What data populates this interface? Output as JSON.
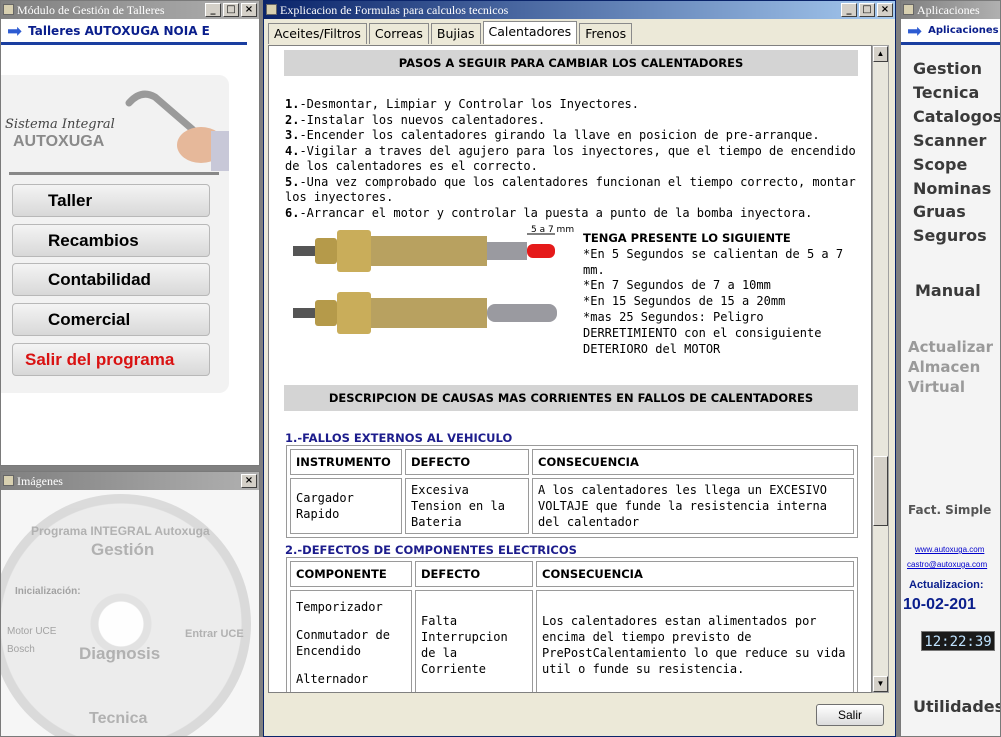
{
  "left_window": {
    "title": "Módulo de Gestión de Talleres",
    "header": "Talleres AUTOXUGA NOIA E",
    "logo_line1": "Sistema Integral",
    "logo_line2": "AUTOXUGA",
    "buttons": [
      "Taller",
      "Recambios",
      "Contabilidad",
      "Comercial",
      "Salir del programa"
    ]
  },
  "images_window": {
    "title": "Imágenes",
    "img_texts": [
      "Programa INTEGRAL Autoxuga",
      "Gestión",
      "Diagnosis",
      "Tecnica",
      "Inicialización:",
      "Motor UCE",
      "Entrar UCE",
      "Bosch"
    ]
  },
  "main_window": {
    "title": "Explicacion de Formulas para calculos tecnicos",
    "tabs": [
      "Aceites/Filtros",
      "Correas",
      "Bujias",
      "Calentadores",
      "Frenos"
    ],
    "heading1": "PASOS A SEGUIR PARA CAMBIAR LOS CALENTADORES",
    "steps": [
      {
        "n": "1.",
        "t": "-Desmontar, Limpiar y Controlar los Inyectores."
      },
      {
        "n": "2.",
        "t": "-Instalar los nuevos calentadores."
      },
      {
        "n": "3.",
        "t": "-Encender los calentadores girando la llave en posicion de pre-arranque."
      },
      {
        "n": "4.",
        "t": "-Vigilar a traves del agujero para los inyectores, que el tiempo de encendido de los calentadores es el correcto."
      },
      {
        "n": "5.",
        "t": "-Una vez comprobado que los calentadores funcionan el tiempo correcto, montar los inyectores."
      },
      {
        "n": "6.",
        "t": "-Arrancar el motor y controlar la puesta a punto de la bomba inyectora."
      }
    ],
    "plug_label": "5 a 7 mm",
    "warn_title": "TENGA PRESENTE LO SIGUIENTE",
    "warn_lines": [
      "*En 5 Segundos se calientan de 5 a 7 mm.",
      "*En 7 Segundos de 7 a 10mm",
      "*En 15 Segundos de 15 a 20mm",
      "*mas 25 Segundos: Peligro DERRETIMIENTO con el consiguiente DETERIORO del MOTOR"
    ],
    "heading2": "DESCRIPCION DE CAUSAS MAS CORRIENTES EN FALLOS DE CALENTADORES",
    "section1": {
      "title": "1.-FALLOS EXTERNOS AL VEHICULO",
      "headers": [
        "INSTRUMENTO",
        "DEFECTO",
        "CONSECUENCIA"
      ],
      "row": [
        "Cargador Rapido",
        "Excesiva Tension en la Bateria",
        "A los calentadores les llega un EXCESIVO VOLTAJE que funde la resistencia interna del calentador"
      ]
    },
    "section2": {
      "title": "2.-DEFECTOS DE COMPONENTES ELECTRICOS",
      "headers": [
        "COMPONENTE",
        "DEFECTO",
        "CONSECUENCIA"
      ],
      "components": [
        "Temporizador",
        "Conmutador de Encendido",
        "Alternador"
      ],
      "defect": "Falta Interrupcion de la Corriente",
      "consequence": "Los calentadores estan alimentados por encima del tiempo previsto de PrePostCalentamiento lo que reduce su vida util o funde su resistencia."
    },
    "close_button": "Salir"
  },
  "right_window": {
    "title": "Aplicaciones",
    "header": "Aplicaciones",
    "links": [
      "Gestion",
      "Tecnica",
      "Catalogos",
      "Scanner",
      "Scope",
      "Nominas",
      "Gruas",
      "Seguros"
    ],
    "manual": "Manual",
    "actualizar": [
      "Actualizar",
      "Almacen",
      "Virtual"
    ],
    "fact": "Fact. Simple",
    "web": "www.autoxuga.com",
    "email": "castro@autoxuga.com",
    "update_label": "Actualizacion:",
    "update_date": "10-02-201",
    "clock": "12:22:39",
    "utilidades": "Utilidades"
  }
}
